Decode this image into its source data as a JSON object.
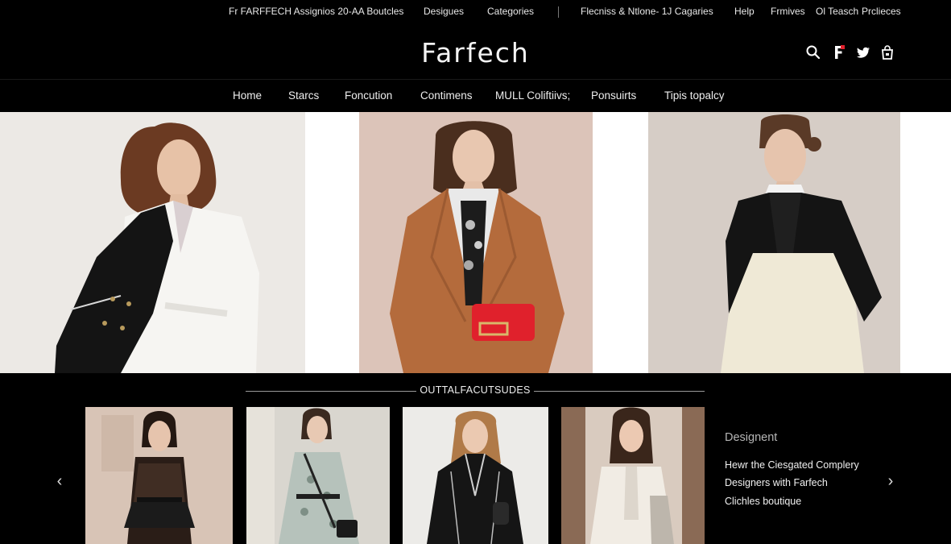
{
  "topbar": {
    "promo": "Fr FARFFECH Assignios 20-AA Boutcles",
    "links": [
      "Desigues",
      "Categories"
    ],
    "middle": "Flecniss & Ntlone- 1J Cagaries",
    "right_links": [
      "Help",
      "Frmives",
      "Ol Teasch",
      "Prclieces"
    ]
  },
  "brand": {
    "logo": "Farfech"
  },
  "header_icons": [
    "search-icon",
    "farfetch-f-icon",
    "twitter-icon",
    "shopping-bag-icon"
  ],
  "nav": {
    "items": [
      "Home",
      "Starcs",
      "Foncution",
      "Contimens",
      "MULL Coliftiivs;",
      "Ponsuirts",
      "Tipis topalcy"
    ]
  },
  "colors": {
    "background": "#000000",
    "accent_red": "#e0212c",
    "camel_coat": "#b46b3c",
    "cream": "#efe9d6"
  },
  "section": {
    "title": "OUTTALFACUTSUDES"
  },
  "sidebar": {
    "heading": "Designent",
    "lines": [
      "Hewr the Ciesgated Complery",
      "Designers with Farfech",
      "Clichles boutique"
    ]
  },
  "carousel": {
    "prev": "‹",
    "next": "›"
  }
}
